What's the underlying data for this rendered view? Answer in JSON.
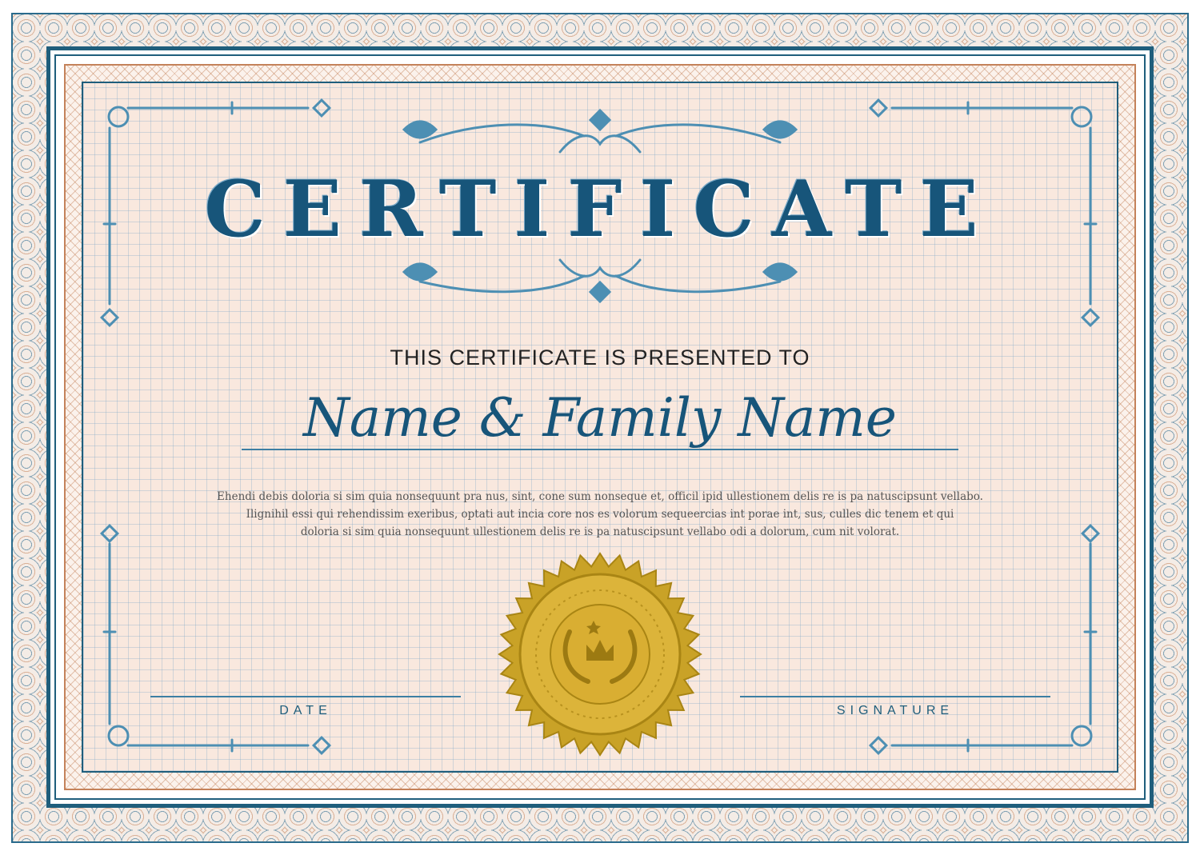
{
  "certificate": {
    "title": "CERTIFICATE",
    "presented_to": "THIS CERTIFICATE IS PRESENTED TO",
    "recipient": "Name & Family Name",
    "body": [
      "Ehendi debis doloria si sim quia nonsequunt pra nus, sint, cone sum nonseque et, officil ipid ullestionem delis re is pa natuscipsunt vellabo.",
      "Ilignihil essi qui rehendissim exeribus, optati aut incia core nos es volorum sequeercias int porae int, sus, culles dic tenem et qui",
      "doloria si sim quia nonsequunt ullestionem delis re is pa natuscipsunt vellabo odi a dolorum, cum nit volorat."
    ],
    "date_label": "DATE",
    "signature_label": "SIGNATURE"
  },
  "colors": {
    "primary_blue": "#17557a",
    "accent_blue": "#3c7fa3",
    "copper": "#c4825a",
    "paper": "#f9e8de",
    "seal_gold": "#d4a82a"
  },
  "icons": {
    "seal": "gold-seal-icon",
    "crown": "crown-icon",
    "laurel": "laurel-wreath-icon",
    "flourish": "flourish-ornament-icon"
  }
}
